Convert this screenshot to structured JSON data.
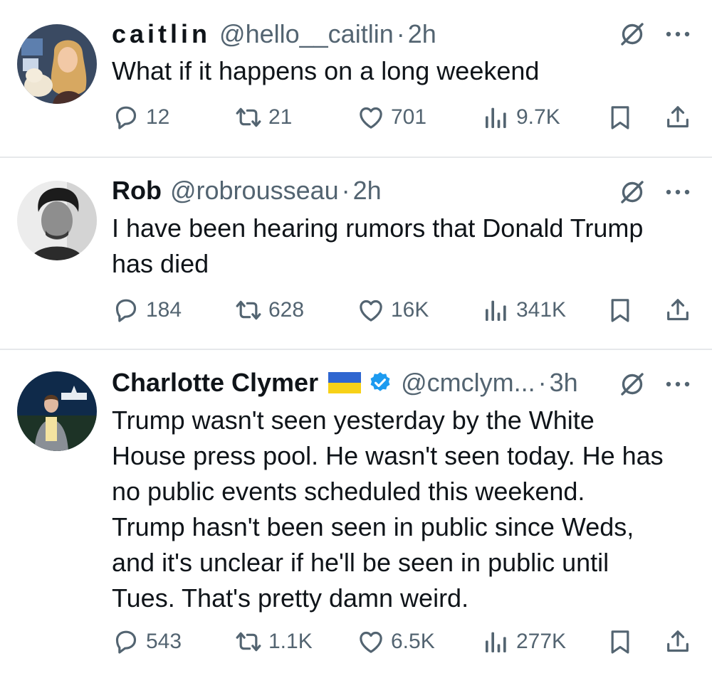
{
  "colors": {
    "text_primary": "#0f1419",
    "text_secondary": "#536471",
    "divider": "#e6e8eb",
    "verified_blue": "#1d9bf0",
    "flag_blue": "#2f66d0",
    "flag_yellow": "#f7d117"
  },
  "tweets": [
    {
      "author": {
        "name": "caitlin",
        "handle": "@hello__caitlin",
        "dot": "·",
        "time": "2h"
      },
      "text": [
        "What if it happens on a long weekend"
      ],
      "stats": {
        "replies": "12",
        "reposts": "21",
        "likes": "701",
        "views": "9.7K"
      },
      "icons": [
        "reply-icon",
        "repost-icon",
        "like-icon",
        "views-icon",
        "bookmark-icon",
        "share-icon",
        "mute-icon",
        "more-icon"
      ]
    },
    {
      "author": {
        "name": "Rob",
        "handle": "@robrousseau",
        "dot": "·",
        "time": "2h"
      },
      "text": [
        "I have been hearing rumors that Donald Trump",
        "has died"
      ],
      "stats": {
        "replies": "184",
        "reposts": "628",
        "likes": "16K",
        "views": "341K"
      },
      "icons": [
        "reply-icon",
        "repost-icon",
        "like-icon",
        "views-icon",
        "bookmark-icon",
        "share-icon",
        "mute-icon",
        "more-icon"
      ]
    },
    {
      "author": {
        "name": "Charlotte Clymer",
        "handle": "@cmclym...",
        "dot": "·",
        "time": "3h",
        "badges": [
          "ukraine-flag-icon",
          "verified-badge-icon"
        ]
      },
      "text": [
        "Trump wasn't seen yesterday by the White",
        "House press pool. He wasn't seen today. He has",
        "no public events scheduled this weekend.",
        "Trump hasn't been seen in public since Weds,",
        "and it's unclear if he'll be seen in public until",
        "Tues. That's pretty damn weird."
      ],
      "stats": {
        "replies": "543",
        "reposts": "1.1K",
        "likes": "6.5K",
        "views": "277K"
      },
      "icons": [
        "reply-icon",
        "repost-icon",
        "like-icon",
        "views-icon",
        "bookmark-icon",
        "share-icon",
        "mute-icon",
        "more-icon"
      ]
    }
  ]
}
